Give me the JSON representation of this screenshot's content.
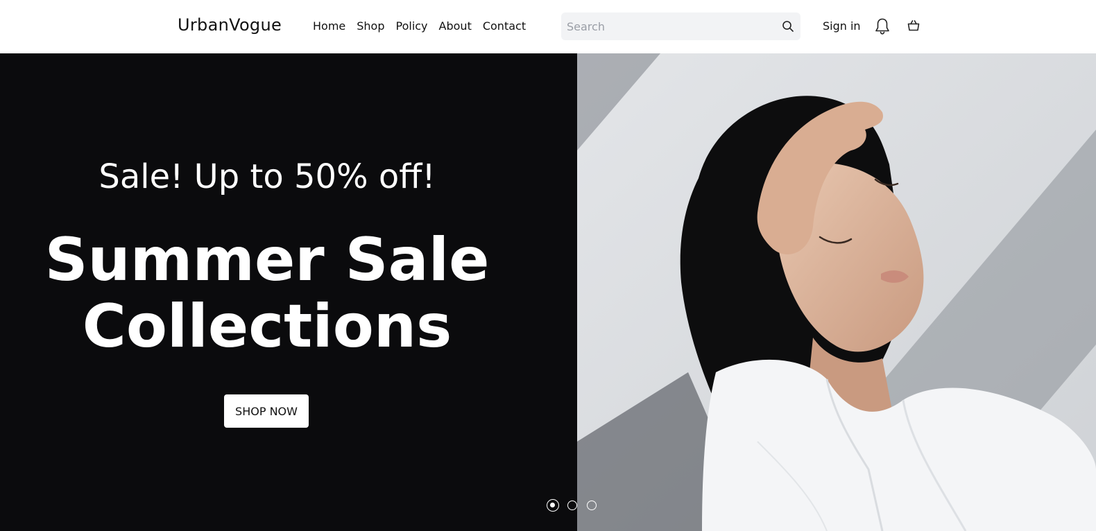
{
  "header": {
    "logo": "UrbanVogue",
    "nav": [
      "Home",
      "Shop",
      "Policy",
      "About",
      "Contact"
    ],
    "search_placeholder": "Search",
    "signin_label": "Sign in"
  },
  "hero": {
    "subtitle": "Sale! Up to 50% off!",
    "title_line1": "Summer Sale",
    "title_line2": "Collections",
    "cta_label": "SHOP NOW",
    "carousel": {
      "slide_count": 3,
      "active_index": 0
    }
  },
  "icons": {
    "search": "search-icon",
    "bell": "bell-icon",
    "cart": "shopping-basket-icon"
  },
  "colors": {
    "hero_background": "#0b0b0d",
    "search_background": "#f2f3f5",
    "text_dark": "#111111",
    "text_light": "#ffffff"
  }
}
